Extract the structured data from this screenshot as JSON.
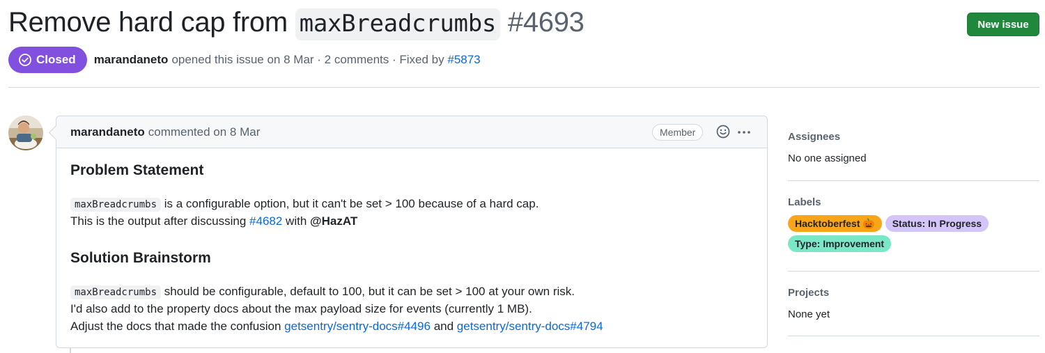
{
  "issue": {
    "title_prefix": "Remove hard cap from ",
    "title_code": "maxBreadcrumbs",
    "number": "#4693",
    "state": "Closed",
    "author": "marandaneto",
    "opened_text": "opened this issue on 8 Mar · 2 comments · Fixed by",
    "fixed_by": "#5873"
  },
  "header": {
    "new_issue_label": "New issue"
  },
  "comment": {
    "author": "marandaneto",
    "commented_text": "commented on 8 Mar",
    "role_badge": "Member",
    "sections": [
      {
        "heading": "Problem Statement"
      },
      {
        "heading": "Solution Brainstorm"
      }
    ],
    "line1_code": "maxBreadcrumbs",
    "line1_text": "is a configurable option, but it can't be set > 100 because of a hard cap.",
    "line2_text": "This is the output after discussing",
    "line2_link": "#4682",
    "line2_with": "with",
    "line2_mention": "@HazAT",
    "line3_code": "maxBreadcrumbs",
    "line3_text": "should be configurable, default to 100, but it can be set > 100 at your own risk.",
    "line4_text": "I'd also add to the property docs about the max payload size for events (currently 1 MB).",
    "line5_text": "Adjust the docs that made the confusion",
    "line5_link1": "getsentry/sentry-docs#4496",
    "line5_and": "and",
    "line5_link2": "getsentry/sentry-docs#4794"
  },
  "sidebar": {
    "assignees_title": "Assignees",
    "assignees_value": "No one assigned",
    "labels_title": "Labels",
    "labels": [
      {
        "name": "Hacktoberfest 🎃",
        "color": "#f9a51a"
      },
      {
        "name": "Status: In Progress",
        "color": "#d4c5f9"
      },
      {
        "name": "Type: Improvement",
        "color": "#7ae7c7"
      }
    ],
    "projects_title": "Projects",
    "projects_value": "None yet"
  },
  "icons": {
    "state": "check-circle-icon",
    "reaction": "smiley-icon",
    "menu": "kebab-horizontal-icon"
  },
  "colors": {
    "closed_purple": "#8250df",
    "primary_green": "#1f883d",
    "link_blue": "#0969da"
  }
}
